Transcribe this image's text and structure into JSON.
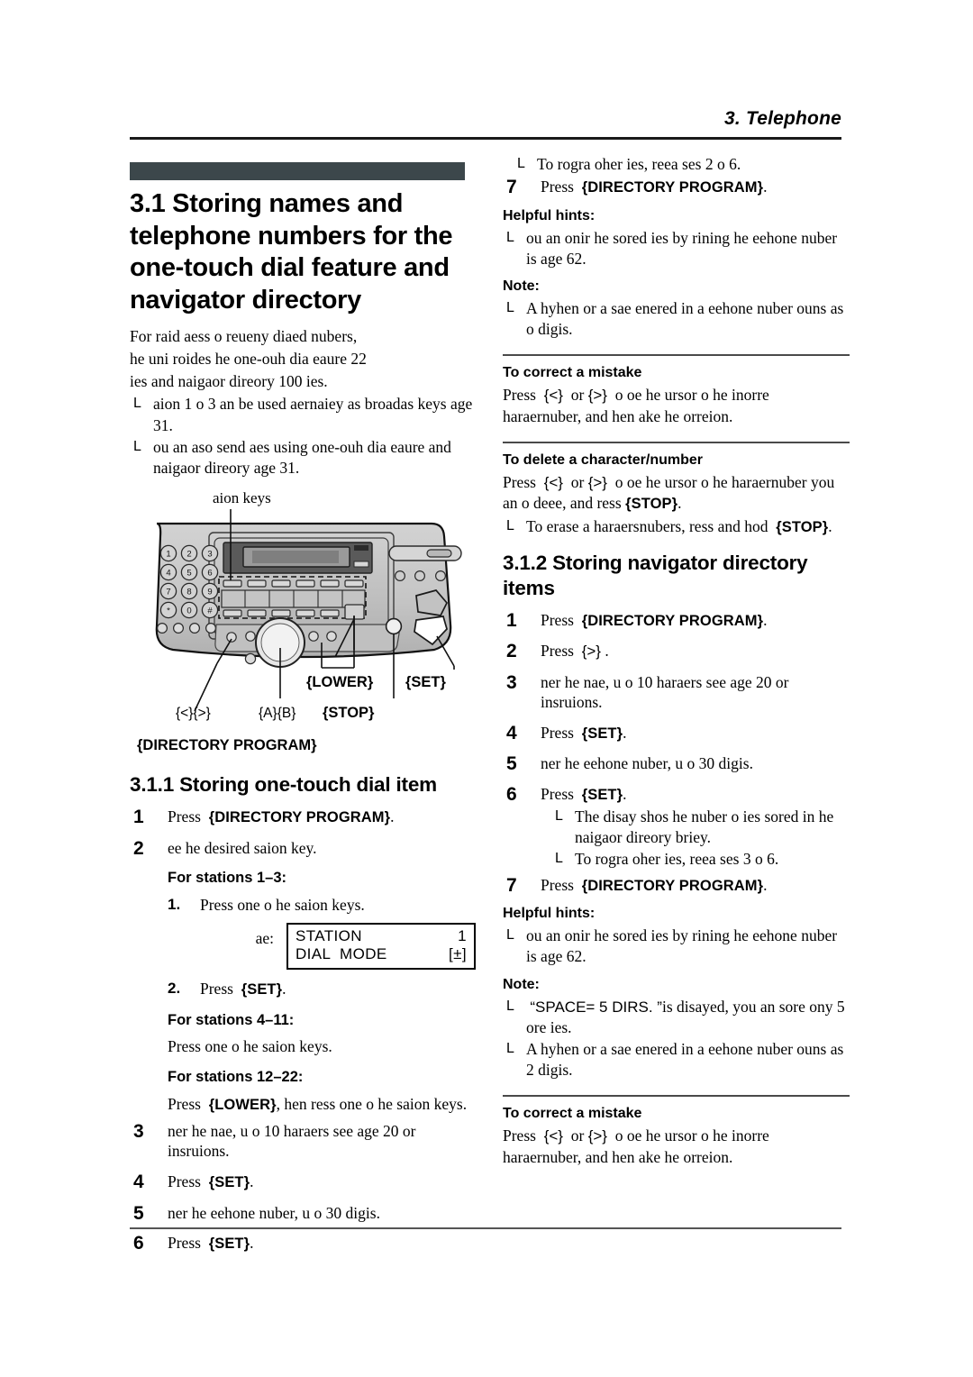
{
  "header": {
    "running_title": "3. Telephone"
  },
  "left_column": {
    "section": {
      "number_and_title": "3.1 Storing names and telephone numbers for the one-touch dial feature and navigator directory",
      "intro_lines": [
        "For raid aess o reueny diaed nubers,",
        "he uni roides he one-ouh dia eaure 22",
        "ies and naigaor direory 100 ies."
      ],
      "intro_bullets": [
        "aion 1 o 3 an be used aernaiey as broadas keys age 31.",
        "ou an aso send aes using one-ouh dia eaure and naigaor direory age 31."
      ]
    },
    "figure": {
      "top_label": "aion keys",
      "callouts": {
        "lower": "{LOWER}",
        "set": "{SET}",
        "arrows": "{<}{>}",
        "ab": "{A}{B}",
        "stop": "{STOP}",
        "directory_program": "{DIRECTORY PROGRAM}"
      }
    },
    "subsection": {
      "title": "3.1.1 Storing one-touch dial item",
      "steps": [
        {
          "num": "1",
          "lead": "Press",
          "key": "{DIRECTORY PROGRAM}",
          "tail": "."
        },
        {
          "num": "2",
          "text": "ee he desired saion key."
        },
        {
          "num": "3",
          "text": "ner he nae, u o 10 haraers see age 20 or insruions."
        },
        {
          "num": "4",
          "lead": "Press",
          "key": "{SET}",
          "tail": "."
        },
        {
          "num": "5",
          "text": "ner he eehone nuber, u o 30 digis."
        },
        {
          "num": "6",
          "lead": "Press",
          "key": "{SET}",
          "tail": "."
        }
      ],
      "stations_1_3": {
        "heading": "For stations 1–3:",
        "substeps": [
          {
            "num": "1.",
            "text": "Press one o he saion keys."
          },
          {
            "num": "2.",
            "lead": "Press",
            "key": "{SET}",
            "tail": "."
          }
        ],
        "example_label": "ae:",
        "lcd_line1_left": "STATION",
        "lcd_line1_right": "1",
        "lcd_line2_left": "DIAL  MODE",
        "lcd_line2_right": "[±]"
      },
      "stations_4_11": {
        "heading": "For stations 4–11:",
        "text": "Press one o he saion keys."
      },
      "stations_12_22": {
        "heading": "For stations 12–22:",
        "lead": "Press",
        "key": "{LOWER}",
        "tail": ", hen ress one o he saion keys."
      }
    }
  },
  "right_column": {
    "continued_bullet": "To rogra oher ies, reea ses 2 o 6.",
    "step7_a": {
      "num": "7",
      "lead": "Press",
      "key": "{DIRECTORY PROGRAM}",
      "tail": "."
    },
    "hints_a": {
      "heading": "Helpful hints:",
      "bullets": [
        "ou an onir he sored ies by rining he eehone nuber is age 62."
      ]
    },
    "note_a": {
      "heading": "Note:",
      "bullets": [
        "A hyhen or a sae enered in a eehone nuber ouns as o digis."
      ]
    },
    "correct_mistake_a": {
      "heading": "To correct a mistake",
      "lead": "Press",
      "key1": "{<}",
      "mid": "or",
      "key2": "{>}",
      "tail": "o oe he ursor o he inorre haraernuber, and hen ake he orreion."
    },
    "delete_char": {
      "heading": "To delete a character/number",
      "lead": "Press",
      "key1": "{<}",
      "mid": "or",
      "key2": "{>}",
      "tail": "o oe he ursor o he haraernuber you an o deee, and ress",
      "key3": "{STOP}",
      "tail2": ".",
      "bullet_lead": "To erase a haraersnubers, ress and hod",
      "bullet_key": "{STOP}",
      "bullet_tail": "."
    },
    "subsection2": {
      "title": "3.1.2 Storing navigator directory items",
      "steps": [
        {
          "num": "1",
          "lead": "Press",
          "key": "{DIRECTORY PROGRAM}",
          "tail": "."
        },
        {
          "num": "2",
          "lead": "Press",
          "key": "{>}",
          "tail": "."
        },
        {
          "num": "3",
          "text": "ner he nae, u o 10 haraers see age 20 or insruions."
        },
        {
          "num": "4",
          "lead": "Press",
          "key": "{SET}",
          "tail": "."
        },
        {
          "num": "5",
          "text": "ner he eehone nuber, u o 30 digis."
        },
        {
          "num": "6",
          "lead": "Press",
          "key": "{SET}",
          "tail": "."
        }
      ],
      "step6_bullets": [
        "The disay shos he nuber o ies sored in he naigaor direory briey.",
        "To rogra oher ies, reea ses 3 o 6."
      ],
      "step7_b": {
        "num": "7",
        "lead": "Press",
        "key": "{DIRECTORY PROGRAM}",
        "tail": "."
      },
      "hints_b": {
        "heading": "Helpful hints:",
        "bullets": [
          "ou an onir he sored ies by rining he eehone nuber is age 62."
        ]
      },
      "note_b": {
        "heading": "Note:",
        "bullet1_quote": "“SPACE= 5 DIRS. ”",
        "bullet1_tail": "is disayed, you an sore ony 5 ore ies.",
        "bullet2": "A hyhen or a sae enered in a eehone nuber ouns as 2 digis."
      }
    },
    "correct_mistake_b": {
      "heading": "To correct a mistake",
      "lead": "Press",
      "key1": "{<}",
      "mid": "or",
      "key2": "{>}",
      "tail": "o oe he ursor o he inorre haraernuber, and hen ake he orreion."
    }
  },
  "colors": {
    "chapter_bar": "#3c474b",
    "rule": "#1a1a1a",
    "device_body": "#c9c9c9",
    "device_panel": "#b5b5b5",
    "lcd_dark": "#595959"
  }
}
